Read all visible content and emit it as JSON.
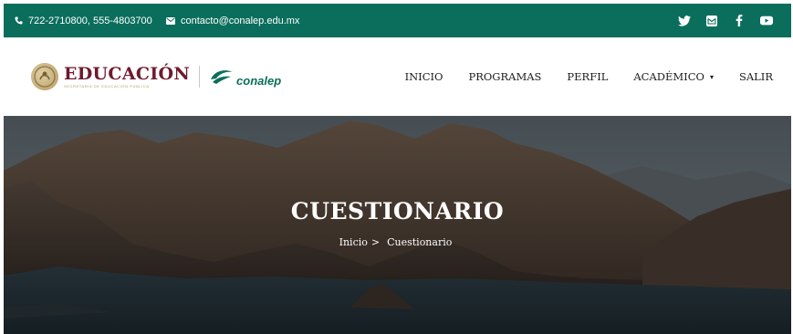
{
  "topbar": {
    "phone": "722-2710800, 555-4803700",
    "email": "contacto@conalep.edu.mx",
    "social": [
      "twitter-icon",
      "mail-icon",
      "facebook-icon",
      "youtube-icon"
    ],
    "background": "#0b6e5c"
  },
  "brand": {
    "education_title": "EDUCACIÓN",
    "education_subtitle": "SECRETARÍA DE EDUCACIÓN PÚBLICA",
    "conalep": "conalep",
    "title_color": "#6e1a2e",
    "conalep_color": "#0b6e5c"
  },
  "nav": {
    "items": [
      "INICIO",
      "PROGRAMAS",
      "PERFIL",
      "ACADÉMICO",
      "SALIR"
    ],
    "dropdown_caret": "▾"
  },
  "hero": {
    "title": "CUESTIONARIO",
    "breadcrumb": {
      "home": "Inicio",
      "separator": ">",
      "current": "Cuestionario"
    }
  }
}
